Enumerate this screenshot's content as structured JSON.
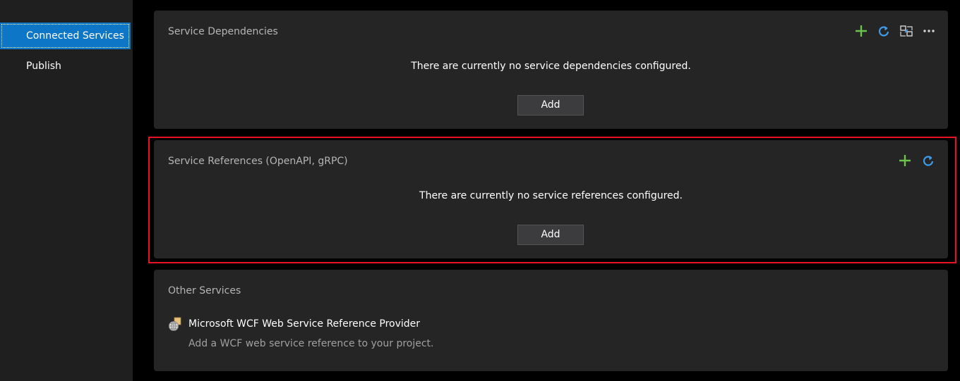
{
  "sidebar": {
    "items": [
      {
        "label": "Connected Services",
        "selected": true
      },
      {
        "label": "Publish",
        "selected": false
      }
    ]
  },
  "service_dependencies": {
    "title": "Service Dependencies",
    "empty_message": "There are currently no service dependencies configured.",
    "add_label": "Add",
    "toolbar": [
      "add-icon",
      "refresh-icon",
      "manage-icon",
      "more-icon"
    ]
  },
  "service_references": {
    "title": "Service References (OpenAPI, gRPC)",
    "empty_message": "There are currently no service references configured.",
    "add_label": "Add",
    "toolbar": [
      "add-icon",
      "refresh-icon"
    ],
    "highlighted": true
  },
  "other_services": {
    "title": "Other Services",
    "providers": [
      {
        "name": "Microsoft WCF Web Service Reference Provider",
        "description": "Add a WCF web service reference to your project.",
        "icon": "wcf-globe-icon"
      }
    ]
  },
  "colors": {
    "accent": "#0e76c7",
    "add_icon": "#6cc24a",
    "refresh_icon": "#3f9ae8",
    "highlight_border": "#e81123",
    "card_background": "#252526"
  }
}
